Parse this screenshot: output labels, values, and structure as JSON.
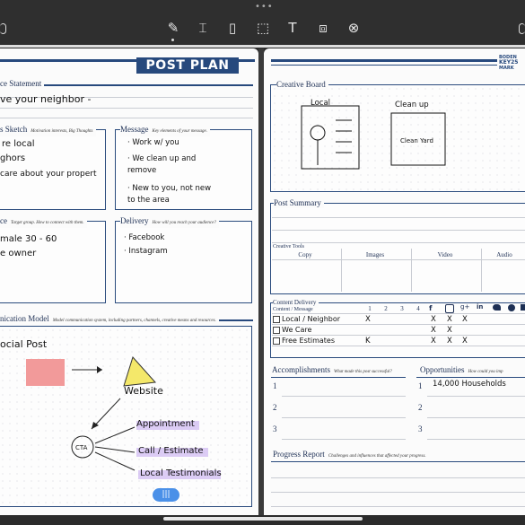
{
  "toolbar": {
    "tools": [
      {
        "name": "pen-tool-icon",
        "glyph": "✎"
      },
      {
        "name": "highlighter-tool-icon",
        "glyph": "⌶"
      },
      {
        "name": "eraser-tool-icon",
        "glyph": "▯"
      },
      {
        "name": "lasso-tool-icon",
        "glyph": "⬚"
      },
      {
        "name": "text-tool-icon",
        "glyph": "T"
      },
      {
        "name": "presentation-tool-icon",
        "glyph": "⧈"
      },
      {
        "name": "close-tool-icon",
        "glyph": "⊗"
      }
    ]
  },
  "left_page": {
    "title": "POST PLAN",
    "sections": {
      "statement": {
        "label": "ce Statement",
        "ink": "ve your neighbor -"
      },
      "sketch": {
        "label": "s Sketch",
        "hint": "Motivation interests, Big Thoughts",
        "ink": [
          "re local",
          "ghors",
          "care about your propert"
        ]
      },
      "message": {
        "label": "Message",
        "hint": "Key elements of your message.",
        "ink": [
          "· Work w/ you",
          "· We clean up and",
          "  remove",
          "· New to you, not new",
          "  to the area"
        ]
      },
      "audience": {
        "label": "ce",
        "hint": "Target group. How to connect with them.",
        "ink": [
          "male  30 - 60",
          "e owner"
        ]
      },
      "delivery": {
        "label": "Delivery",
        "hint": "How will you reach your audience?",
        "ink": [
          "· Facebook",
          "· Instagram"
        ]
      },
      "comm_model": {
        "label": "nication Model",
        "hint": "Model communication system, including partners, channels, creative means and resources.",
        "ink": {
          "social": "ocial Post",
          "website": "Website",
          "cta": "CTA",
          "outputs": [
            "Appointment",
            "Call / Estimate",
            "Local Testimonials"
          ]
        }
      }
    },
    "page_pill": "|||"
  },
  "right_page": {
    "logo_lines": [
      "BODEN",
      "KEY25",
      "MARK"
    ],
    "creative_board": {
      "label": "Creative Board",
      "ink": [
        "Local",
        "Clean up",
        "Clean Yard"
      ]
    },
    "post_summary": {
      "label": "Post Summary"
    },
    "creative_tools": {
      "label": "Creative Tools",
      "columns": [
        "Copy",
        "Images",
        "Video",
        "Audio"
      ]
    },
    "content_delivery": {
      "label": "Content Delivery",
      "column_header": "Content / Message",
      "numbers": [
        "1",
        "2",
        "3",
        "4"
      ],
      "channel_icons": [
        "facebook-icon",
        "instagram-icon",
        "google-plus-icon",
        "linkedin-icon",
        "twitter-icon",
        "vimeo-icon",
        "youtube-icon"
      ],
      "rows": [
        {
          "text": "Local / Neighbor",
          "marks": [
            "X",
            "",
            "",
            "",
            "X",
            "X",
            "X"
          ]
        },
        {
          "text": "We Care",
          "marks": [
            "",
            "",
            "",
            "",
            "X",
            "X",
            ""
          ]
        },
        {
          "text": "Free Estimates",
          "marks": [
            "K",
            "",
            "",
            "",
            "X",
            "X",
            "X"
          ]
        }
      ]
    },
    "accomplishments": {
      "label": "Accomplishments",
      "hint": "What made this post successful?",
      "numbers": [
        "1",
        "2",
        "3"
      ]
    },
    "opportunities": {
      "label": "Opportunities",
      "hint": "How could you imp",
      "numbers": [
        "1",
        "2",
        "3"
      ],
      "ink": "14,000 Households"
    },
    "progress": {
      "label": "Progress Report",
      "hint": "Challenges and influences that affected your progress."
    }
  },
  "colors": {
    "navy": "#27497d",
    "highlight": "#cdb6f1",
    "pink": "#f29a9a",
    "yellow": "#f4e86a",
    "pill": "#4a90e8"
  }
}
